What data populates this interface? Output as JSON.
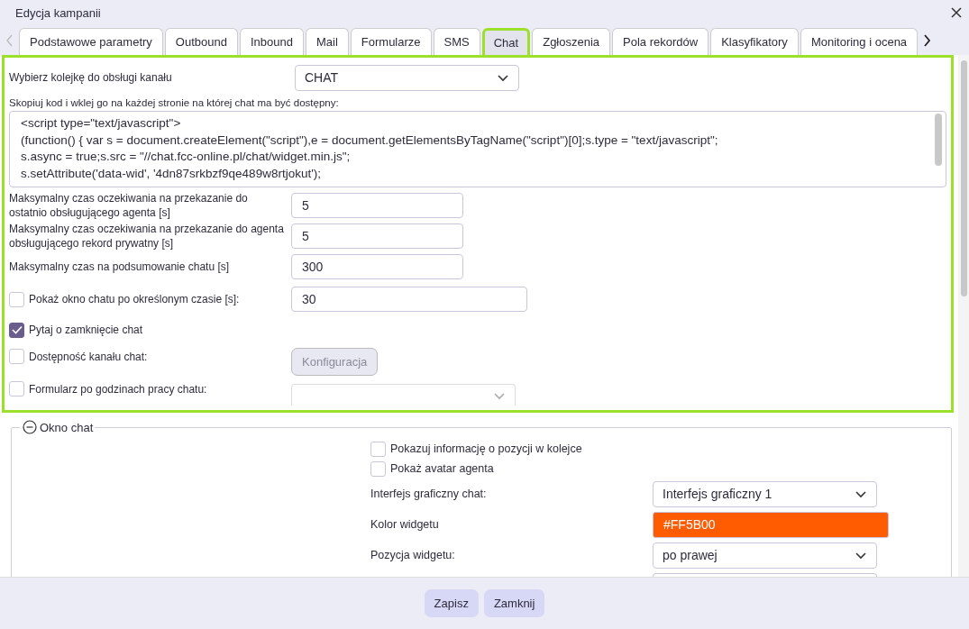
{
  "window": {
    "title": "Edycja kampanii"
  },
  "tabs": [
    {
      "label": "Podstawowe parametry",
      "selected": false
    },
    {
      "label": "Outbound",
      "selected": false
    },
    {
      "label": "Inbound",
      "selected": false
    },
    {
      "label": "Mail",
      "selected": false
    },
    {
      "label": "Formularze",
      "selected": false
    },
    {
      "label": "SMS",
      "selected": false
    },
    {
      "label": "Chat",
      "selected": true
    },
    {
      "label": "Zgłoszenia",
      "selected": false
    },
    {
      "label": "Pola rekordów",
      "selected": false
    },
    {
      "label": "Klasyfikatory",
      "selected": false
    },
    {
      "label": "Monitoring i ocena",
      "selected": false
    }
  ],
  "queue": {
    "label": "Wybierz kolejkę do obsługi kanału",
    "value": "CHAT"
  },
  "embed_code": {
    "label": "Skopiuj kod i wklej go na każdej stronie na której chat ma być dostępny:",
    "lines": [
      "<script type=\"text/javascript\">",
      "(function() { var s = document.createElement(\"script\"),e = document.getElementsByTagName(\"script\")[0];s.type = \"text/javascript\";",
      "s.async = true;s.src = \"//chat.fcc-online.pl/chat/widget.min.js\";",
      "s.setAttribute('data-wid', '4dn87srkbzf9qe489w8rtjokut');"
    ]
  },
  "fields": [
    {
      "kind": "input",
      "label": "Maksymalny czas oczekiwania na przekazanie do ostatnio obsługującego agenta [s]",
      "value": "5"
    },
    {
      "kind": "input",
      "label": "Maksymalny czas oczekiwania na przekazanie do agenta obsługującego rekord prywatny [s]",
      "value": "5"
    },
    {
      "kind": "input",
      "label": "Maksymalny czas na podsumowanie chatu [s]",
      "value": "300"
    },
    {
      "kind": "checkbox-input",
      "checked": false,
      "label": "Pokaż okno chatu po określonym czasie [s]:",
      "value": "30"
    },
    {
      "kind": "checkbox",
      "checked": true,
      "label": "Pytaj o zamknięcie chat"
    },
    {
      "kind": "checkbox-button",
      "checked": false,
      "label": "Dostępność kanału chat:",
      "button": "Konfiguracja",
      "disabled": true
    },
    {
      "kind": "checkbox-select",
      "checked": false,
      "label": "Formularz po godzinach pracy chatu:",
      "disabled": true
    }
  ],
  "chat_window": {
    "title": "Okno chat",
    "expanded": true,
    "items": [
      {
        "kind": "checkbox",
        "checked": false,
        "label": "Pokazuj informację o pozycji w kolejce"
      },
      {
        "kind": "checkbox",
        "checked": false,
        "label": "Pokaż avatar agenta"
      },
      {
        "kind": "select",
        "label": "Interfejs graficzny chat:",
        "value": "Interfejs graficzny 1"
      },
      {
        "kind": "color",
        "label": "Kolor widgetu",
        "value": "#FF5B00",
        "color": "#ff5b00"
      },
      {
        "kind": "select",
        "label": "Pozycja widgetu:",
        "value": "po prawej"
      },
      {
        "kind": "select"
      }
    ]
  },
  "footer_buttons": [
    "Zapisz",
    "Zamknij"
  ]
}
